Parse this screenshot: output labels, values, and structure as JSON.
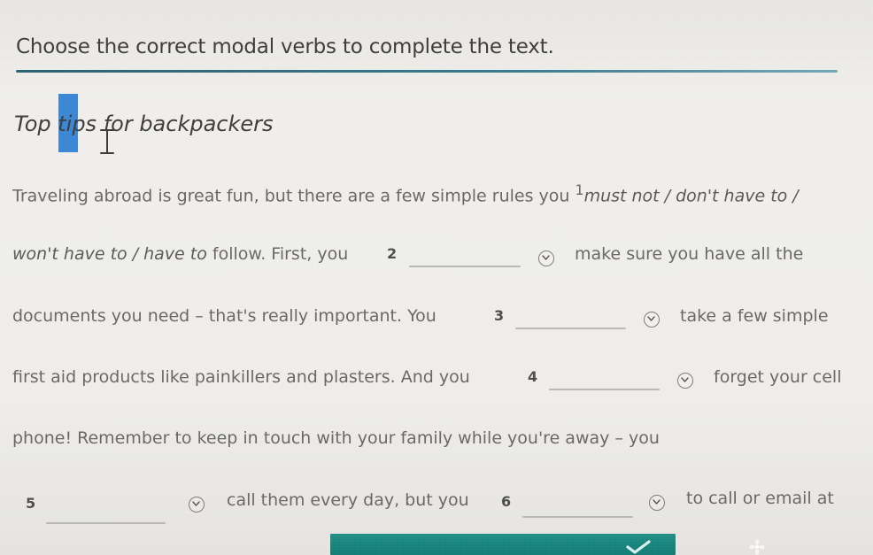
{
  "header": {
    "instruction": "Choose the correct modal verbs to complete the text."
  },
  "article": {
    "title": "Top tips for backpackers",
    "line1_text": "Traveling abroad is great fun, but there are a few simple rules you ",
    "line1_superscript": "1",
    "line1_options": "must not / don't have to /",
    "line2_options": "won't have to / have to",
    "line2_text": " follow. First, you",
    "line3_text": "documents you need – that's really important. You",
    "line4_text": "first aid products like painkillers and plasters. And you",
    "line5_text": "phone! Remember to keep in touch with your family while you're away – you",
    "gap2_number": "2",
    "gap2_after": "make sure you have all the",
    "gap3_number": "3",
    "gap3_after": "take a few simple",
    "gap4_number": "4",
    "gap4_after": "forget your cell",
    "gap5_number": "5",
    "gap5_after": "call them every day, but you",
    "gap6_number": "6",
    "gap6_after": "to call or email at"
  },
  "icons": {
    "dropdown": "chevron-down-circle-icon",
    "check": "check-icon",
    "flower": "flower-icon"
  },
  "colors": {
    "accent": "#1d5a69",
    "selection": "#2f7fd3",
    "bottom_bar": "#117b73"
  }
}
